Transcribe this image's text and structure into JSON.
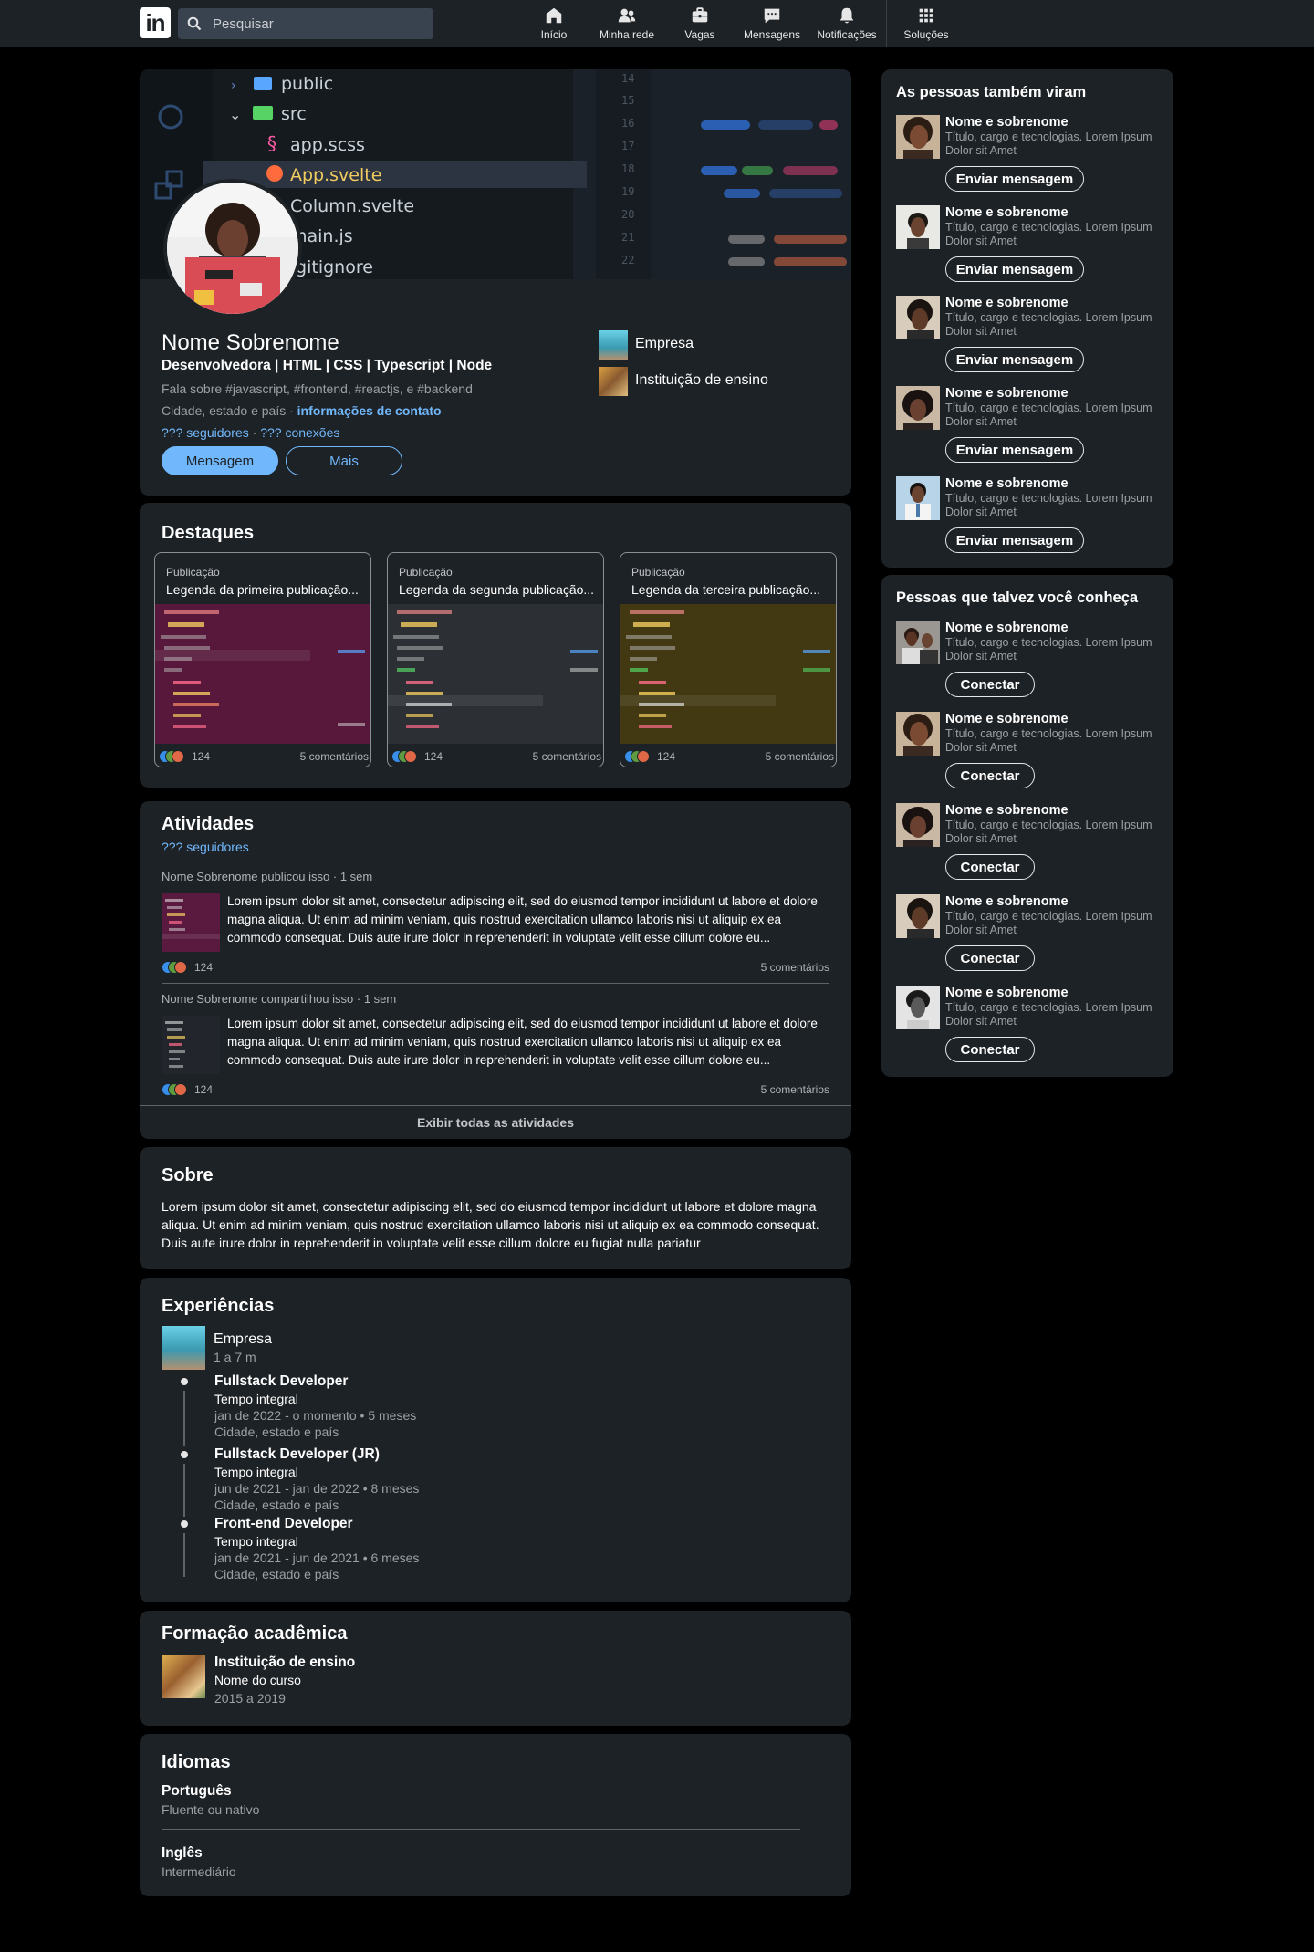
{
  "nav": {
    "search_placeholder": "Pesquisar",
    "items": [
      {
        "label": "Início",
        "icon": "home-icon"
      },
      {
        "label": "Minha rede",
        "icon": "network-icon"
      },
      {
        "label": "Vagas",
        "icon": "briefcase-icon"
      },
      {
        "label": "Mensagens",
        "icon": "messages-icon"
      },
      {
        "label": "Notificações",
        "icon": "bell-icon"
      },
      {
        "label": "Soluções",
        "icon": "grid-icon"
      }
    ]
  },
  "profile": {
    "cover_code": {
      "line_numbers": [
        "14",
        "15",
        "16",
        "17",
        "18",
        "19",
        "20",
        "21",
        "22"
      ],
      "tree": [
        "public",
        "src",
        "app.scss",
        "App.svelte",
        "Column.svelte",
        "main.js",
        ".gitignore"
      ]
    },
    "name": "Nome Sobrenome",
    "headline": "Desenvolvedora | HTML | CSS | Typescript | Node",
    "about_short": "Fala sobre #javascript, #frontend, #reactjs, e #backend",
    "location": "Cidade, estado e país",
    "separator": "·",
    "contact_link": "informações de contato",
    "followers": "??? seguidores",
    "connections": "??? conexões",
    "message_button": "Mensagem",
    "more_button": "Mais",
    "company": "Empresa",
    "school": "Instituição de ensino"
  },
  "featured": {
    "title": "Destaques",
    "items": [
      {
        "kind": "Publicação",
        "caption": "Legenda da primeira publicação...",
        "reactions": "124",
        "comments": "5 comentários",
        "tint": "#8a1e5a"
      },
      {
        "kind": "Publicação",
        "caption": "Legenda da segunda publicação...",
        "reactions": "124",
        "comments": "5 comentários",
        "tint": "#3a3e44"
      },
      {
        "kind": "Publicação",
        "caption": "Legenda da terceira publicação...",
        "reactions": "124",
        "comments": "5 comentários",
        "tint": "#6a5a12"
      }
    ]
  },
  "activity": {
    "title": "Atividades",
    "followers": "??? seguidores",
    "posts": [
      {
        "head": "Nome Sobrenome publicou isso · 1 sem",
        "text": "Lorem ipsum dolor sit amet, consectetur adipiscing elit, sed do eiusmod tempor incididunt ut labore et dolore magna aliqua. Ut enim ad minim veniam, quis nostrud exercitation ullamco laboris nisi ut aliquip ex ea commodo consequat. Duis aute irure dolor in reprehenderit in voluptate velit esse cillum dolore eu...",
        "reactions": "124",
        "comments": "5 comentários"
      },
      {
        "head": "Nome Sobrenome compartilhou isso · 1 sem",
        "text": "Lorem ipsum dolor sit amet, consectetur adipiscing elit, sed do eiusmod tempor incididunt ut labore et dolore magna aliqua. Ut enim ad minim veniam, quis nostrud exercitation ullamco laboris nisi ut aliquip ex ea commodo consequat. Duis aute irure dolor in reprehenderit in voluptate velit esse cillum dolore eu...",
        "reactions": "124",
        "comments": "5 comentários"
      }
    ],
    "show_all": "Exibir todas as atividades"
  },
  "about": {
    "title": "Sobre",
    "text": "Lorem ipsum dolor sit amet, consectetur adipiscing elit, sed do eiusmod tempor incididunt ut labore et dolore magna aliqua. Ut enim ad minim veniam, quis nostrud exercitation ullamco laboris nisi ut aliquip ex ea commodo consequat. Duis aute irure dolor in reprehenderit in voluptate velit esse cillum dolore eu fugiat nulla pariatur"
  },
  "experience": {
    "title": "Experiências",
    "company": "Empresa",
    "total": "1 a 7 m",
    "roles": [
      {
        "title": "Fullstack Developer",
        "type": "Tempo integral",
        "period": "jan de 2022 - o momento • 5 meses",
        "location": "Cidade, estado e país"
      },
      {
        "title": "Fullstack Developer (JR)",
        "type": "Tempo integral",
        "period": "jun de 2021 - jan de 2022 • 8 meses",
        "location": "Cidade, estado e país"
      },
      {
        "title": "Front-end Developer",
        "type": "Tempo integral",
        "period": "jan de 2021 - jun de 2021 • 6 meses",
        "location": "Cidade, estado e país"
      }
    ]
  },
  "education": {
    "title": "Formação acadêmica",
    "school": "Instituição de ensino",
    "course": "Nome do curso",
    "years": "2015 a 2019"
  },
  "languages": {
    "title": "Idiomas",
    "items": [
      {
        "name": "Português",
        "level": "Fluente ou nativo"
      },
      {
        "name": "Inglês",
        "level": "Intermediário"
      }
    ]
  },
  "also_viewed": {
    "title": "As pessoas também viram",
    "people": [
      {
        "name": "Nome e sobrenome",
        "title": "Título, cargo e tecnologias. Lorem Ipsum Dolor sit Amet",
        "button": "Enviar mensagem"
      },
      {
        "name": "Nome e sobrenome",
        "title": "Título, cargo e tecnologias. Lorem Ipsum Dolor sit Amet",
        "button": "Enviar mensagem"
      },
      {
        "name": "Nome e sobrenome",
        "title": "Título, cargo e tecnologias. Lorem Ipsum Dolor sit Amet",
        "button": "Enviar mensagem"
      },
      {
        "name": "Nome e sobrenome",
        "title": "Título, cargo e tecnologias. Lorem Ipsum Dolor sit Amet",
        "button": "Enviar mensagem"
      },
      {
        "name": "Nome e sobrenome",
        "title": "Título, cargo e tecnologias. Lorem Ipsum Dolor sit Amet",
        "button": "Enviar mensagem"
      }
    ]
  },
  "may_know": {
    "title": "Pessoas que talvez você conheça",
    "people": [
      {
        "name": "Nome e sobrenome",
        "title": "Título, cargo e tecnologias. Lorem Ipsum Dolor sit Amet",
        "button": "Conectar"
      },
      {
        "name": "Nome e sobrenome",
        "title": "Título, cargo e tecnologias. Lorem Ipsum Dolor sit Amet",
        "button": "Conectar"
      },
      {
        "name": "Nome e sobrenome",
        "title": "Título, cargo e tecnologias. Lorem Ipsum Dolor sit Amet",
        "button": "Conectar"
      },
      {
        "name": "Nome e sobrenome",
        "title": "Título, cargo e tecnologias. Lorem Ipsum Dolor sit Amet",
        "button": "Conectar"
      },
      {
        "name": "Nome e sobrenome",
        "title": "Título, cargo e tecnologias. Lorem Ipsum Dolor sit Amet",
        "button": "Conectar"
      }
    ]
  },
  "colors": {
    "accent": "#71b7fb",
    "card": "#1d2226",
    "background": "#000000"
  }
}
